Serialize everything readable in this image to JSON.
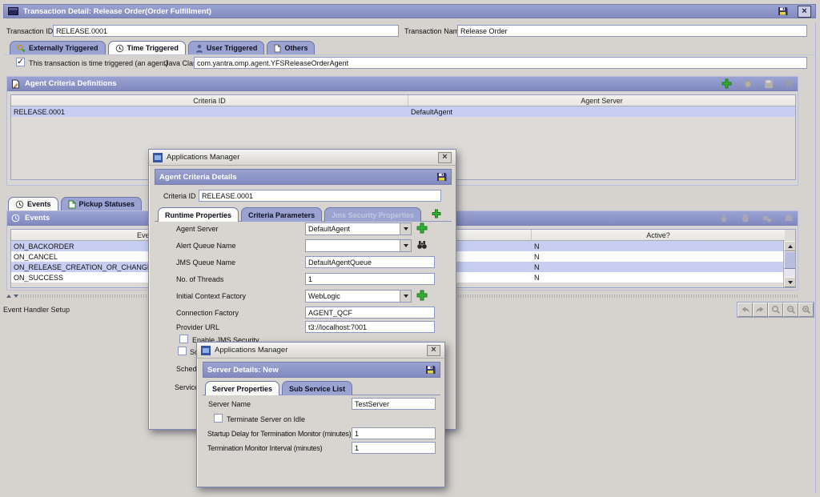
{
  "colors": {
    "accent": "#8b93c7",
    "tab_unselected": "#9aa3d1",
    "row_selected": "#c7cef2",
    "add_green": "#33b033",
    "window_bg": "#d6d3ce"
  },
  "main_window": {
    "title": "Transaction Detail: Release Order(Order Fulfillment)",
    "transaction_id": {
      "label": "Transaction ID",
      "value": "RELEASE.0001"
    },
    "transaction_name": {
      "label": "Transaction Name",
      "value": "Release Order"
    },
    "tabs": [
      {
        "label": "Externally Triggered",
        "icon": "key-icon",
        "selected": false
      },
      {
        "label": "Time Triggered",
        "icon": "clock-icon",
        "selected": true
      },
      {
        "label": "User Triggered",
        "icon": "user-icon",
        "selected": false
      },
      {
        "label": "Others",
        "icon": "document-icon",
        "selected": false
      }
    ],
    "time_triggered_tab": {
      "checkbox": {
        "label": "This transaction is time triggered (an agent)",
        "checked": true
      },
      "java_class": {
        "label": "Java Class",
        "value": "com.yantra.omp.agent.YFSReleaseOrderAgent"
      }
    }
  },
  "agent_criteria_panel": {
    "title": "Agent Criteria Definitions",
    "toolbar_icons": [
      "add-icon",
      "view-details-icon",
      "save-icon",
      "delete-icon"
    ],
    "columns": [
      "Criteria ID",
      "Agent Server"
    ],
    "rows": [
      {
        "criteria_id": "RELEASE.0001",
        "agent_server": "DefaultAgent"
      }
    ]
  },
  "events_section": {
    "tabs": [
      {
        "label": "Events",
        "icon": "clock-icon",
        "selected": true
      },
      {
        "label": "Pickup Statuses",
        "icon": "document-icon",
        "selected": false
      }
    ],
    "panel_title": "Events",
    "columns": [
      "Event",
      "Active?"
    ],
    "rows": [
      {
        "event": "ON_BACKORDER",
        "active": "N"
      },
      {
        "event": "ON_CANCEL",
        "active": "N"
      },
      {
        "event": "ON_RELEASE_CREATION_OR_CHANGE",
        "active": "N"
      },
      {
        "event": "ON_SUCCESS",
        "active": "N"
      }
    ]
  },
  "status_text": "Event Handler Setup",
  "bottom_toolbar_icons": [
    "undo-icon",
    "redo-icon",
    "zoom-icon",
    "zoom-out-icon",
    "zoom-in-icon"
  ],
  "agent_criteria_dialog": {
    "window_title": "Applications Manager",
    "panel_title": "Agent Criteria Details",
    "criteria_id": {
      "label": "Criteria ID",
      "value": "RELEASE.0001"
    },
    "tabs": [
      {
        "label": "Runtime Properties",
        "selected": true,
        "disabled": false
      },
      {
        "label": "Criteria Parameters",
        "selected": false,
        "disabled": false
      },
      {
        "label": "Jms Security Properties",
        "selected": false,
        "disabled": true
      }
    ],
    "fields": [
      {
        "label": "Agent Server",
        "value": "DefaultAgent",
        "control": "combo",
        "button": "add-icon"
      },
      {
        "label": "Alert Queue Name",
        "value": "",
        "control": "combo",
        "button": "search-icon"
      },
      {
        "label": "JMS Queue Name",
        "value": "DefaultAgentQueue",
        "control": "text"
      },
      {
        "label": "No. of Threads",
        "value": "1",
        "control": "text"
      },
      {
        "label": "Initial Context Factory",
        "value": "WebLogic",
        "control": "combo",
        "button": "add-icon"
      },
      {
        "label": "Connection Factory",
        "value": "AGENT_QCF",
        "control": "text"
      },
      {
        "label": "Provider URL",
        "value": "t3://localhost:7001",
        "control": "text"
      }
    ],
    "enable_jms_security": {
      "label": "Enable JMS Security",
      "checked": false
    },
    "occluded_fragments": {
      "checkbox_label": "Sch",
      "label_1": "Schedul",
      "label_2": "Service"
    }
  },
  "server_details_dialog": {
    "window_title": "Applications Manager",
    "panel_title": "Server Details: New",
    "tabs": [
      {
        "label": "Server Properties",
        "selected": true
      },
      {
        "label": "Sub Service List",
        "selected": false
      }
    ],
    "server_name": {
      "label": "Server Name",
      "value": "TestServer"
    },
    "terminate_on_idle": {
      "label": "Terminate Server on Idle",
      "checked": false
    },
    "startup_delay": {
      "label": "Startup Delay for Termination Monitor (minutes)",
      "value": "1"
    },
    "termination_interval": {
      "label": "Termination Monitor Interval (minutes)",
      "value": "1"
    }
  }
}
